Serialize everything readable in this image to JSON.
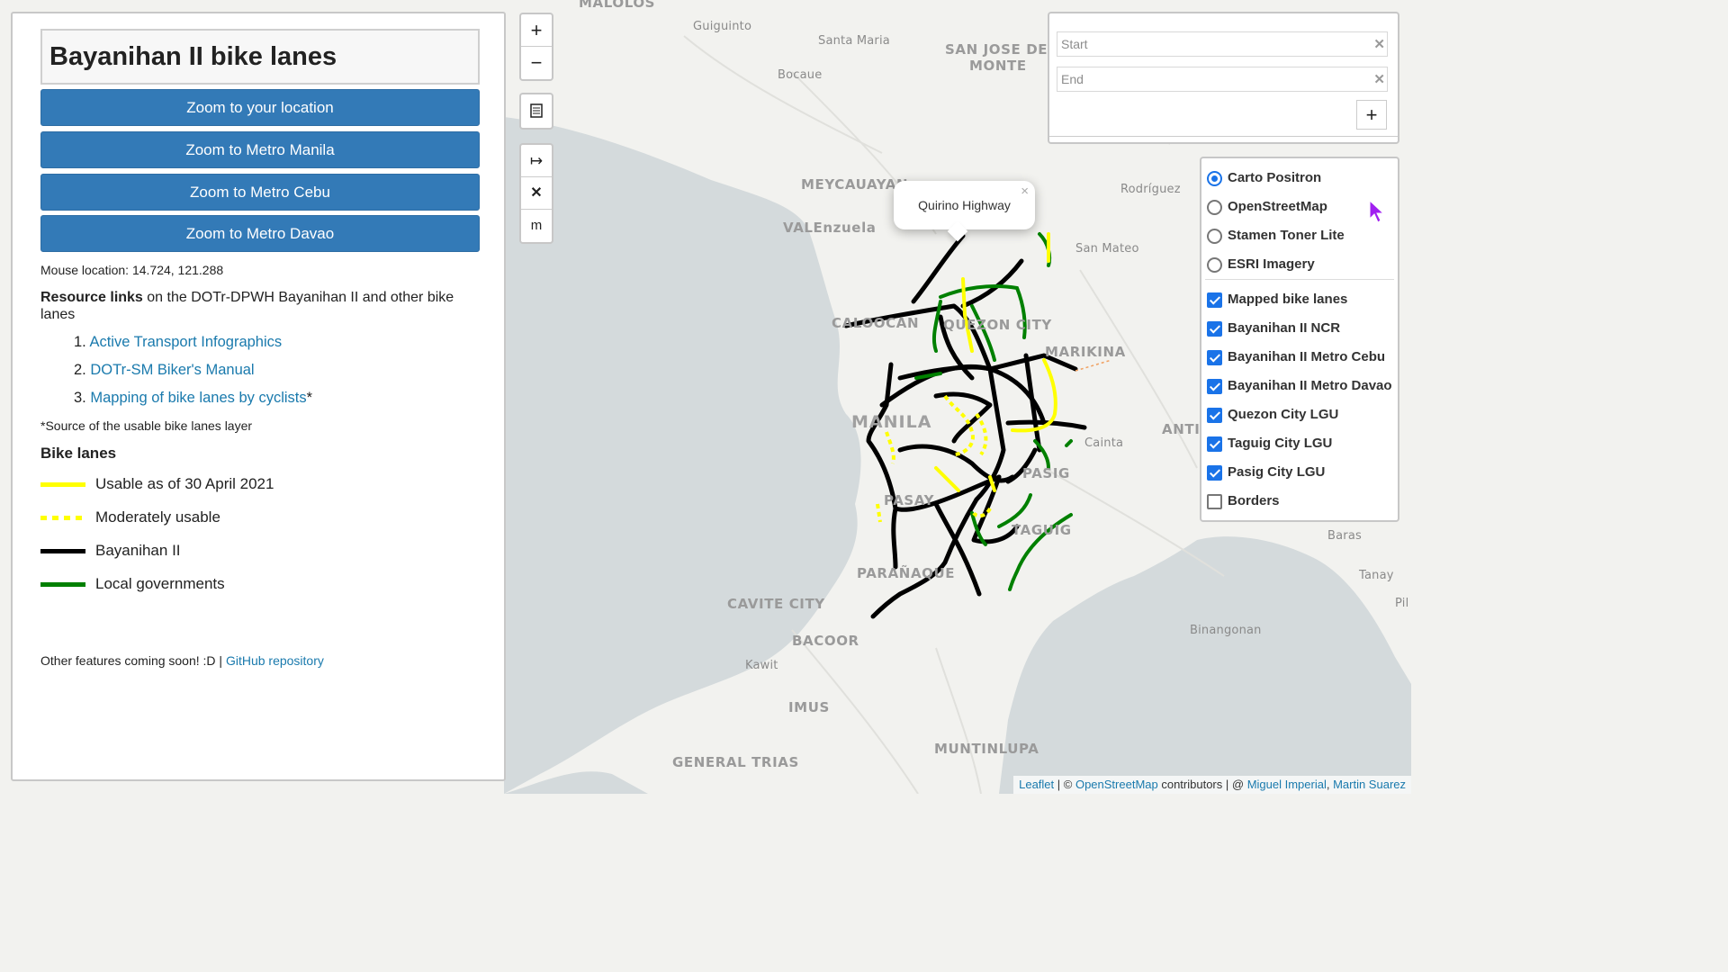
{
  "panel": {
    "title": "Bayanihan II bike lanes",
    "zoom_buttons": [
      "Zoom to your location",
      "Zoom to Metro Manila",
      "Zoom to Metro Cebu",
      "Zoom to Metro Davao"
    ],
    "mouse_location": "Mouse location: 14.724, 121.288",
    "resources_bold": "Resource links",
    "resources_rest": " on the DOTr-DPWH Bayanihan II and other bike lanes",
    "links": [
      {
        "num": "1.",
        "text": "Active Transport Infographics",
        "suffix": ""
      },
      {
        "num": "2.",
        "text": "DOTr-SM Biker's Manual",
        "suffix": ""
      },
      {
        "num": "3.",
        "text": "Mapping of bike lanes by cyclists",
        "suffix": "*"
      }
    ],
    "source_note": "*Source of the usable bike lanes layer",
    "bike_lanes_title": "Bike lanes",
    "legend": [
      {
        "label": "Usable as of 30 April 2021",
        "color": "#ffff00",
        "style": "solid"
      },
      {
        "label": "Moderately usable",
        "color": "#ffff00",
        "style": "dotted"
      },
      {
        "label": "Bayanihan II",
        "color": "#000000",
        "style": "solid"
      },
      {
        "label": "Local governments",
        "color": "#008000",
        "style": "solid"
      }
    ],
    "footer_text": "Other features coming soon! :D | ",
    "footer_link": "GitHub repository"
  },
  "map_controls": {
    "zoom_in": "+",
    "zoom_out": "−",
    "measure_icon": "ruler-icon",
    "tool_buttons": [
      "↦",
      "✕",
      "m"
    ]
  },
  "routing": {
    "start_placeholder": "Start",
    "end_placeholder": "End",
    "clear": "✕",
    "add": "+"
  },
  "layers": {
    "base": [
      {
        "label": "Carto Positron",
        "checked": true
      },
      {
        "label": "OpenStreetMap",
        "checked": false
      },
      {
        "label": "Stamen Toner Lite",
        "checked": false
      },
      {
        "label": "ESRI Imagery",
        "checked": false
      }
    ],
    "overlays": [
      {
        "label": "Mapped bike lanes",
        "checked": true
      },
      {
        "label": "Bayanihan II NCR",
        "checked": true
      },
      {
        "label": "Bayanihan II Metro Cebu",
        "checked": true
      },
      {
        "label": "Bayanihan II Metro Davao",
        "checked": true
      },
      {
        "label": "Quezon City LGU",
        "checked": true
      },
      {
        "label": "Taguig City LGU",
        "checked": true
      },
      {
        "label": "Pasig City LGU",
        "checked": true
      },
      {
        "label": "Borders",
        "checked": false
      }
    ]
  },
  "popup": {
    "text": "Quirino Highway",
    "close": "×"
  },
  "places": [
    {
      "name": "MALOLOS",
      "cls": "big"
    },
    {
      "name": "Guiguinto",
      "cls": ""
    },
    {
      "name": "Santa Maria",
      "cls": ""
    },
    {
      "name": "SAN JOSE DEL",
      "cls": "big"
    },
    {
      "name": "MONTE",
      "cls": "big"
    },
    {
      "name": "Bocaue",
      "cls": ""
    },
    {
      "name": "MEYCAUAYAN",
      "cls": "big"
    },
    {
      "name": "Rodríguez",
      "cls": ""
    },
    {
      "name": "VALEnzuela",
      "cls": "big"
    },
    {
      "name": "San Mateo",
      "cls": ""
    },
    {
      "name": "CALOOCAN",
      "cls": "big"
    },
    {
      "name": "QUEZON CITY",
      "cls": "big"
    },
    {
      "name": "MARIKINA",
      "cls": "big"
    },
    {
      "name": "MANILA",
      "cls": "huge"
    },
    {
      "name": "Cainta",
      "cls": ""
    },
    {
      "name": "ANTI",
      "cls": "big"
    },
    {
      "name": "PASIG",
      "cls": "big"
    },
    {
      "name": "PASAY",
      "cls": "big"
    },
    {
      "name": "TAGUIG",
      "cls": "big"
    },
    {
      "name": "Baras",
      "cls": ""
    },
    {
      "name": "Tanay",
      "cls": ""
    },
    {
      "name": "Pil",
      "cls": ""
    },
    {
      "name": "PARAÑAQUE",
      "cls": "big"
    },
    {
      "name": "CAVITE CITY",
      "cls": "big"
    },
    {
      "name": "BACOOR",
      "cls": "big"
    },
    {
      "name": "Kawit",
      "cls": ""
    },
    {
      "name": "Binangonan",
      "cls": ""
    },
    {
      "name": "IMUS",
      "cls": "big"
    },
    {
      "name": "MUNTINLUPA",
      "cls": "big"
    },
    {
      "name": "GENERAL TRIAS",
      "cls": "big"
    }
  ],
  "attribution": {
    "leaflet": "Leaflet",
    "sep1": " | © ",
    "osm": "OpenStreetMap",
    "mid": " contributors | @ ",
    "author1": "Miguel Imperial",
    "comma": ", ",
    "author2": "Martin Suarez"
  },
  "colors": {
    "water": "#d4dadc",
    "land": "#f2f2ef",
    "bayanihan": "#000000",
    "lgu": "#008000",
    "usable": "#ffff00",
    "button": "#337ab7"
  }
}
